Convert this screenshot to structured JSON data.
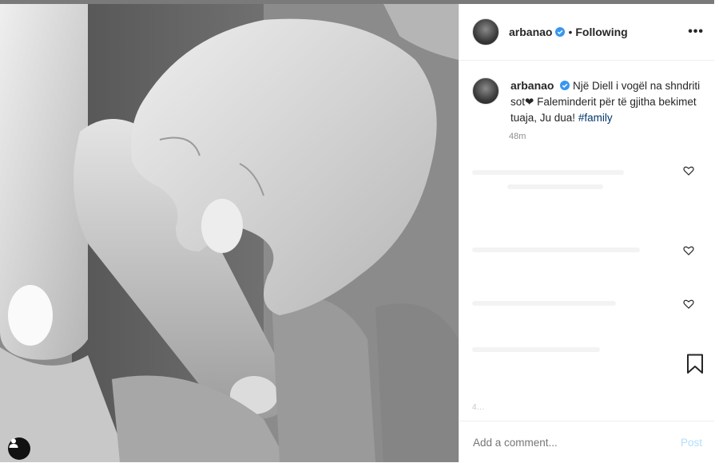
{
  "post": {
    "username": "arbanao",
    "follow_status": "Following",
    "caption_text": "Një Diell i vogël na shndriti sot❤ Faleminderit për të gjitha bekimet tuaja, Ju dua!",
    "hashtag": "#family",
    "time_ago": "48m",
    "likes_text": "4…"
  },
  "comment": {
    "placeholder": "Add a comment...",
    "post_label": "Post"
  },
  "icons": {
    "verified": "verified-badge-icon",
    "more": "more-options-icon",
    "heart": "heart-icon",
    "save": "bookmark-icon",
    "tag": "user-tag-icon"
  },
  "colors": {
    "verified_blue": "#3897f0",
    "hashtag_link": "#00376b",
    "post_button_disabled": "#b2dffc"
  }
}
